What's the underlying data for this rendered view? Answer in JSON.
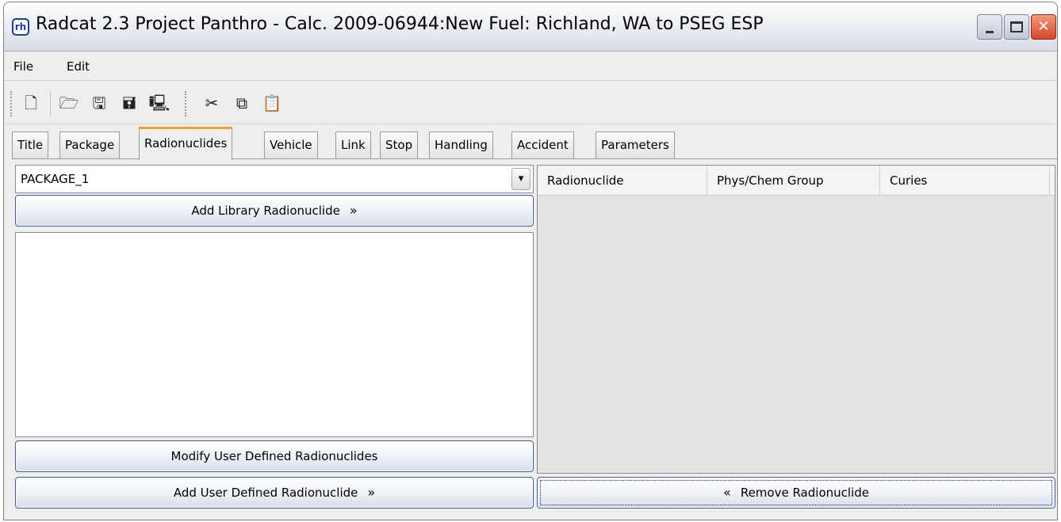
{
  "window": {
    "title": "Radcat 2.3 Project Panthro - Calc. 2009-06944:New Fuel: Richland, WA to PSEG ESP",
    "icon_label": "rh",
    "controls": {
      "minimize": "minimize-icon",
      "maximize": "maximize-icon",
      "close": "✕"
    }
  },
  "menu": {
    "file": "File",
    "edit": "Edit"
  },
  "toolbar": {
    "buttons": [
      {
        "name": "new-file-icon",
        "glyph": "🗋"
      },
      {
        "name": "open-folder-icon",
        "glyph": "🗁"
      },
      {
        "name": "save-icon",
        "glyph": "🖫"
      },
      {
        "name": "save-as-icon",
        "glyph": "🖬"
      },
      {
        "name": "monitor-icon",
        "glyph": "🖳"
      },
      {
        "name": "cut-icon",
        "glyph": "✂"
      },
      {
        "name": "copy-icon",
        "glyph": "⧉"
      },
      {
        "name": "paste-icon",
        "glyph": "📋"
      }
    ]
  },
  "tabs": [
    "Title",
    "Package",
    "Radionuclides",
    "Vehicle",
    "Link",
    "Stop",
    "Handling",
    "Accident",
    "Parameters"
  ],
  "active_tab": "Radionuclides",
  "left_panel": {
    "package_select": {
      "value": "PACKAGE_1",
      "arrow": "▾"
    },
    "add_library_button": "Add Library Radionuclide",
    "modify_user_button": "Modify User Defined Radionuclides",
    "add_user_button": "Add User Defined Radionuclide",
    "chevron_right": "»"
  },
  "right_panel": {
    "columns": [
      "Radionuclide",
      "Phys/Chem Group",
      "Curies"
    ],
    "rows": [],
    "remove_button": "Remove Radionuclide",
    "chevron_left": "«"
  },
  "colors": {
    "active_tab_accent": "#f0a42c",
    "button_border": "#3d5f9f",
    "close_button": "#d8452a"
  }
}
